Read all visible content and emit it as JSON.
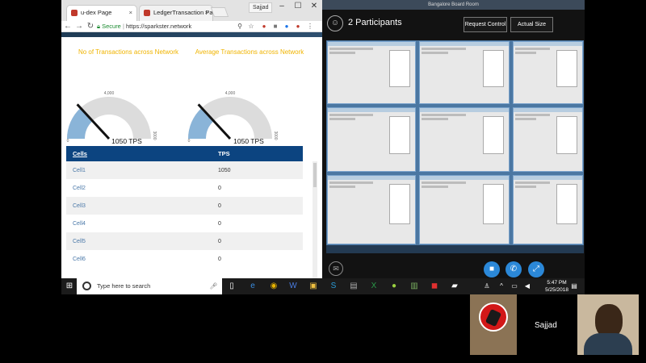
{
  "browser": {
    "tabs": [
      {
        "label": "u-dex Page",
        "active": true
      },
      {
        "label": "LedgerTransaction Page",
        "active": false
      }
    ],
    "user_label": "Sajjad",
    "window_controls": [
      "–",
      "☐",
      "✕"
    ],
    "url_secure_label": "Secure",
    "url": "https://sparkster.network"
  },
  "gauges": [
    {
      "title": "No of Transactions across Network",
      "max_label": "4,000",
      "min_label": "0",
      "side_label": "3000",
      "value": 1050,
      "max": 4000,
      "tps_label": "1050 TPS"
    },
    {
      "title": "Average Transactions across Network",
      "max_label": "4,000",
      "min_label": "0",
      "side_label": "3000",
      "value": 1050,
      "max": 4000,
      "tps_label": "1050 TPS"
    }
  ],
  "table": {
    "headers": [
      "Cells",
      "TPS"
    ],
    "rows": [
      [
        "Cell1",
        "1050"
      ],
      [
        "Cell2",
        "0"
      ],
      [
        "Cell3",
        "0"
      ],
      [
        "Cell4",
        "0"
      ],
      [
        "Cell5",
        "0"
      ],
      [
        "Cell6",
        "0"
      ]
    ]
  },
  "taskbar": {
    "search_placeholder": "Type here to search",
    "time": "5:47 PM",
    "date": "5/25/2018"
  },
  "meeting": {
    "room_title": "Bangalore Board Room",
    "participants": "2 Participants",
    "request_control": "Request Control",
    "actual_size": "Actual Size"
  },
  "video": {
    "remote_name": "Sajjad"
  },
  "colors": {
    "gauge_fill": "#8ab4d8",
    "gauge_track": "#dcdcdc",
    "title_yellow": "#f0b400",
    "table_header": "#0c4480",
    "call_blue": "#2b88d8"
  }
}
